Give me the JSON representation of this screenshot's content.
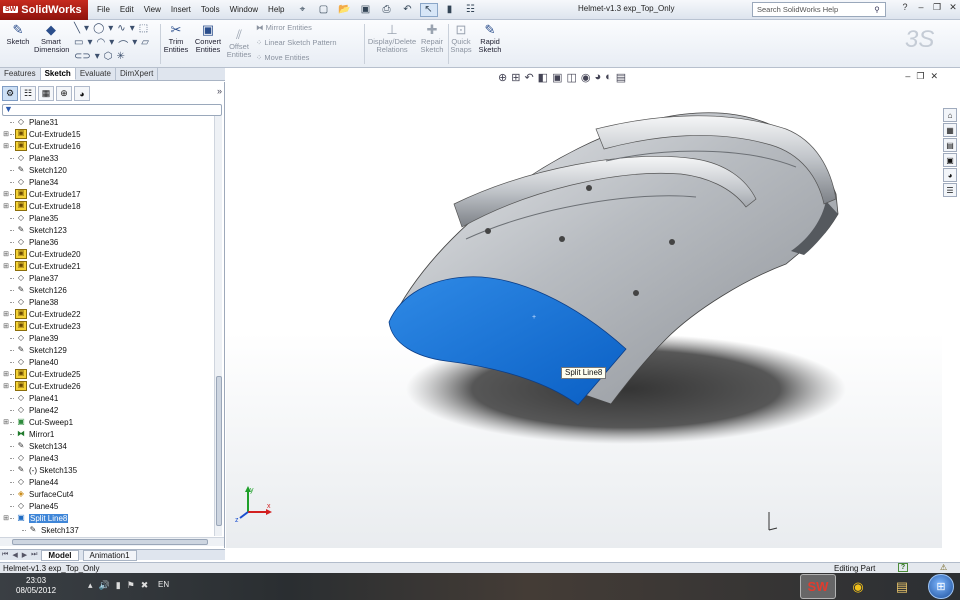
{
  "app": {
    "logo": "SolidWorks",
    "doc_title": "Helmet-v1.3 exp_Top_Only"
  },
  "menu": [
    "File",
    "Edit",
    "View",
    "Insert",
    "Tools",
    "Window",
    "Help"
  ],
  "search": {
    "placeholder": "Search SolidWorks Help"
  },
  "command_manager": {
    "sketch": "Sketch",
    "smart_dimension": [
      "Smart",
      "Dimension"
    ],
    "trim_entities": [
      "Trim",
      "Entities"
    ],
    "convert_entities": [
      "Convert",
      "Entities"
    ],
    "offset_entities": [
      "Offset",
      "Entities"
    ],
    "mirror_entities": "Mirror Entities",
    "linear_sketch_pattern": "Linear Sketch Pattern",
    "move_entities": "Move Entities",
    "display_delete_relations": [
      "Display/Delete",
      "Relations"
    ],
    "repair_sketch": [
      "Repair",
      "Sketch"
    ],
    "quick_snaps": [
      "Quick",
      "Snaps"
    ],
    "rapid_sketch": [
      "Rapid",
      "Sketch"
    ]
  },
  "tabs": [
    "Features",
    "Sketch",
    "Evaluate",
    "DimXpert"
  ],
  "active_tab": "Sketch",
  "tree": [
    {
      "label": "Plane31",
      "type": "plane",
      "exp": false
    },
    {
      "label": "Cut-Extrude15",
      "type": "feat",
      "exp": true
    },
    {
      "label": "Cut-Extrude16",
      "type": "feat",
      "exp": true
    },
    {
      "label": "Plane33",
      "type": "plane",
      "exp": false
    },
    {
      "label": "Sketch120",
      "type": "sketch",
      "exp": false
    },
    {
      "label": "Plane34",
      "type": "plane",
      "exp": false
    },
    {
      "label": "Cut-Extrude17",
      "type": "feat",
      "exp": true
    },
    {
      "label": "Cut-Extrude18",
      "type": "feat",
      "exp": true
    },
    {
      "label": "Plane35",
      "type": "plane",
      "exp": false
    },
    {
      "label": "Sketch123",
      "type": "sketch",
      "exp": false
    },
    {
      "label": "Plane36",
      "type": "plane",
      "exp": false
    },
    {
      "label": "Cut-Extrude20",
      "type": "feat",
      "exp": true
    },
    {
      "label": "Cut-Extrude21",
      "type": "feat",
      "exp": true
    },
    {
      "label": "Plane37",
      "type": "plane",
      "exp": false
    },
    {
      "label": "Sketch126",
      "type": "sketch",
      "exp": false
    },
    {
      "label": "Plane38",
      "type": "plane",
      "exp": false
    },
    {
      "label": "Cut-Extrude22",
      "type": "feat",
      "exp": true
    },
    {
      "label": "Cut-Extrude23",
      "type": "feat",
      "exp": true
    },
    {
      "label": "Plane39",
      "type": "plane",
      "exp": false
    },
    {
      "label": "Sketch129",
      "type": "sketch",
      "exp": false
    },
    {
      "label": "Plane40",
      "type": "plane",
      "exp": false
    },
    {
      "label": "Cut-Extrude25",
      "type": "feat",
      "exp": true
    },
    {
      "label": "Cut-Extrude26",
      "type": "feat",
      "exp": true
    },
    {
      "label": "Plane41",
      "type": "plane",
      "exp": false
    },
    {
      "label": "Plane42",
      "type": "plane",
      "exp": false
    },
    {
      "label": "Cut-Sweep1",
      "type": "sweep",
      "exp": true
    },
    {
      "label": "Mirror1",
      "type": "mirror",
      "exp": false
    },
    {
      "label": "Sketch134",
      "type": "sketch",
      "exp": false
    },
    {
      "label": "Plane43",
      "type": "plane",
      "exp": false
    },
    {
      "label": "(-) Sketch135",
      "type": "sketch",
      "exp": false
    },
    {
      "label": "Plane44",
      "type": "plane",
      "exp": false
    },
    {
      "label": "SurfaceCut4",
      "type": "surf",
      "exp": false
    },
    {
      "label": "Plane45",
      "type": "plane",
      "exp": false
    },
    {
      "label": "Split Line8",
      "type": "split",
      "exp": true,
      "selected": true
    },
    {
      "label": "Sketch137",
      "type": "sketch",
      "exp": false,
      "child": true
    }
  ],
  "bottom_tabs": [
    "Model",
    "Animation1"
  ],
  "viewport": {
    "tooltip": "Split Line8"
  },
  "status": {
    "left": "Helmet-v1.3 exp_Top_Only",
    "right": "Editing Part",
    "help": "?"
  },
  "taskbar": {
    "time": "23:03",
    "date": "08/05/2012",
    "lang": "EN"
  },
  "colors": {
    "selection_face": "#0f6ed8",
    "model_grey": "#a9adb2"
  }
}
